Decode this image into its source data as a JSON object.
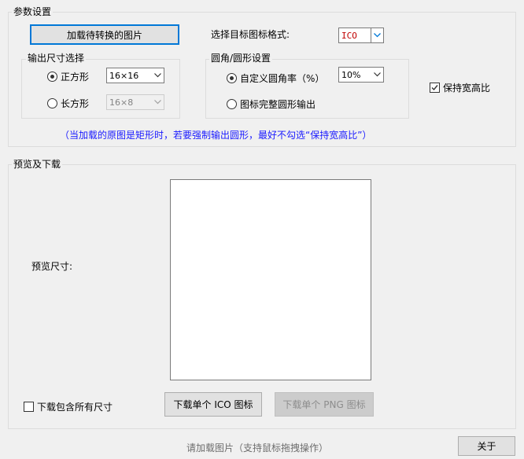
{
  "params": {
    "group_title": "参数设置",
    "load_button": "加载待转换的图片",
    "format_label": "选择目标图标格式:",
    "format_value": "ICO",
    "output_size": {
      "group_title": "输出尺寸选择",
      "square_label": "正方形",
      "square_selected": true,
      "square_value": "16×16",
      "rect_label": "长方形",
      "rect_value": "16×8"
    },
    "round": {
      "group_title": "圆角/圆形设置",
      "custom_label": "自定义圆角率（%）",
      "custom_selected": true,
      "custom_value": "10%",
      "full_label": "图标完整圆形输出"
    },
    "keep_ratio_label": "保持宽高比",
    "keep_ratio_checked": true,
    "note": "（当加载的原图是矩形时，若要强制输出圆形，最好不勾选“保持宽高比”）"
  },
  "preview": {
    "group_title": "预览及下载",
    "size_label": "预览尺寸:",
    "include_all_label": "下载包含所有尺寸",
    "include_all_checked": false,
    "ico_button": "下载单个 ICO 图标",
    "png_button": "下载单个 PNG 图标"
  },
  "status_text": "请加载图片（支持鼠标拖拽操作）",
  "about_button": "关于"
}
